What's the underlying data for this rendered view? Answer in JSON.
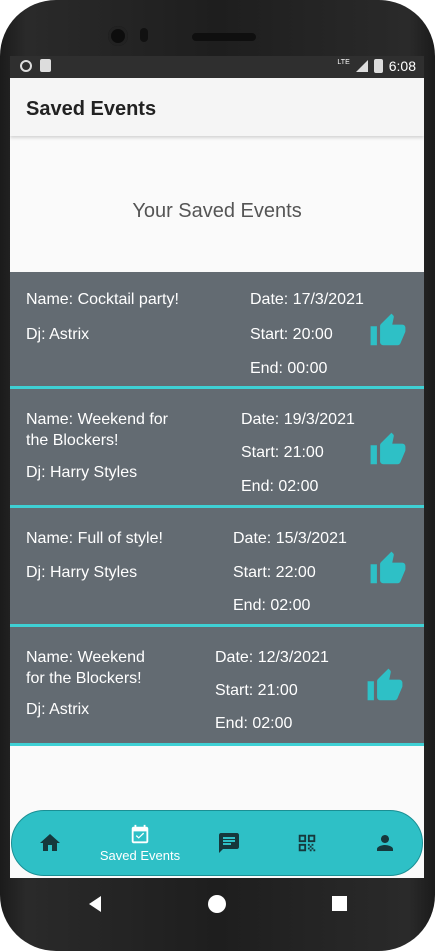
{
  "statusbar": {
    "time": "6:08",
    "network": "LTE"
  },
  "appbar": {
    "title": "Saved Events"
  },
  "page": {
    "heading": "Your Saved Events"
  },
  "events": [
    {
      "name": "Name: Cocktail party!",
      "dj": "Dj: Astrix",
      "date": "Date: 17/3/2021",
      "start": "Start: 20:00",
      "end": "End: 00:00"
    },
    {
      "name": "Name: Weekend for\nthe Blockers!",
      "dj": "Dj: Harry Styles",
      "date": "Date: 19/3/2021",
      "start": "Start: 21:00",
      "end": "End: 02:00"
    },
    {
      "name": "Name: Full of style!",
      "dj": "Dj: Harry Styles",
      "date": "Date: 15/3/2021",
      "start": "Start: 22:00",
      "end": "End: 02:00"
    },
    {
      "name": "Name: Weekend\nfor the Blockers!",
      "dj": "Dj: Astrix",
      "date": "Date: 12/3/2021",
      "start": "Start: 21:00",
      "end": "End: 02:00"
    }
  ],
  "navbar": {
    "items": [
      {
        "icon": "home-icon",
        "label": ""
      },
      {
        "icon": "calendar-check-icon",
        "label": "Saved Events"
      },
      {
        "icon": "chat-icon",
        "label": ""
      },
      {
        "icon": "qr-code-icon",
        "label": ""
      },
      {
        "icon": "person-icon",
        "label": ""
      }
    ]
  },
  "colors": {
    "card": "#636b72",
    "accent": "#2ec0c6",
    "divider": "#3fd0d4",
    "statusbar": "#2f2f2f"
  }
}
